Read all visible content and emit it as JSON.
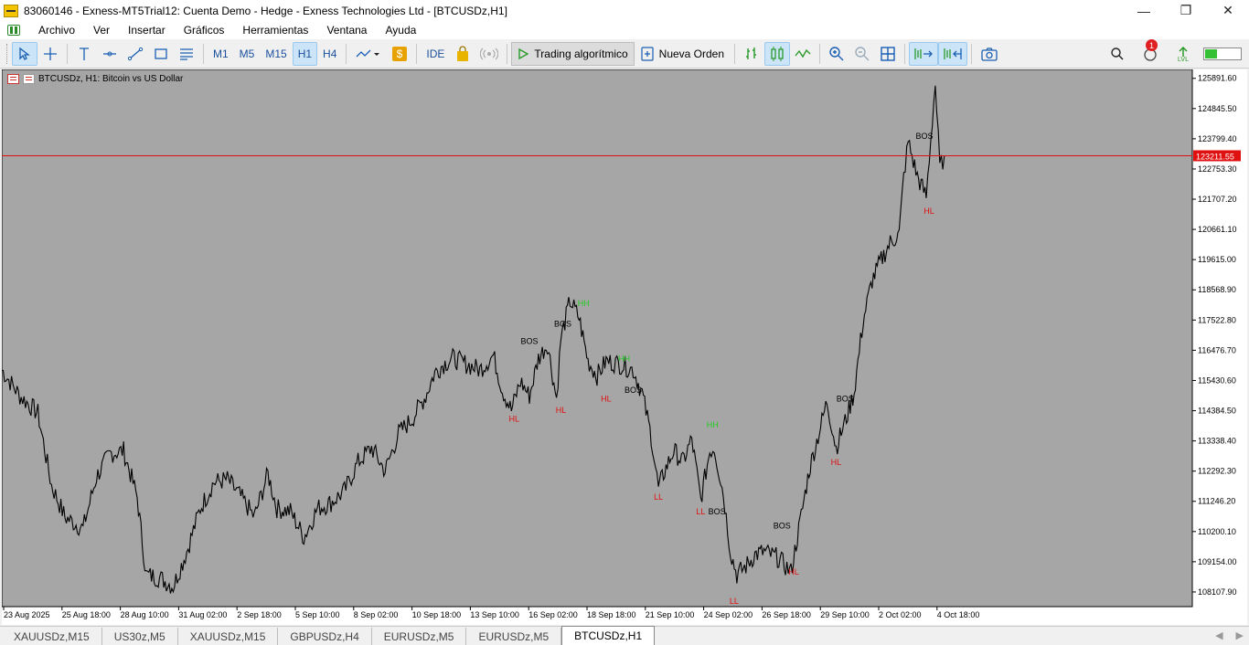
{
  "window": {
    "title": "83060146 - Exness-MT5Trial12: Cuenta Demo - Hedge - Exness Technologies Ltd - [BTCUSDz,H1]",
    "minimize": "—",
    "maximize": "❐",
    "close": "✕"
  },
  "menu": [
    "Archivo",
    "Ver",
    "Insertar",
    "Gráficos",
    "Herramientas",
    "Ventana",
    "Ayuda"
  ],
  "toolbar": {
    "timeframes": [
      "M1",
      "M5",
      "M15",
      "H1",
      "H4"
    ],
    "active_timeframe": "H1",
    "ide_label": "IDE",
    "algo_label": "Trading algorítmico",
    "new_order_label": "Nueva Orden",
    "notifications_count": "1",
    "signal_label": "LVL",
    "battery_level": 0.32
  },
  "chart": {
    "header": "BTCUSDz, H1:  Bitcoin vs US Dollar",
    "current_price": "123211.55",
    "price_line_color": "#e01010"
  },
  "chart_data": {
    "type": "line",
    "symbol": "BTCUSDz",
    "timeframe": "H1",
    "y_ticks": [
      "125891.60",
      "124845.50",
      "123799.40",
      "122753.30",
      "121707.20",
      "120661.10",
      "119615.00",
      "118568.90",
      "117522.80",
      "116476.70",
      "115430.60",
      "114384.50",
      "113338.40",
      "112292.30",
      "111246.20",
      "110200.10",
      "109154.00",
      "108107.90"
    ],
    "x_ticks": [
      "23 Aug 2025",
      "25 Aug 18:00",
      "28 Aug 10:00",
      "31 Aug 02:00",
      "2 Sep 18:00",
      "5 Sep 10:00",
      "8 Sep 02:00",
      "10 Sep 18:00",
      "13 Sep 10:00",
      "16 Sep 02:00",
      "18 Sep 18:00",
      "21 Sep 10:00",
      "24 Sep 02:00",
      "26 Sep 18:00",
      "29 Sep 10:00",
      "2 Oct 02:00",
      "4 Oct 18:00"
    ],
    "ylim": [
      107600,
      126200
    ],
    "x_index_range": [
      0,
      1320
    ],
    "series": [
      {
        "x": [
          0,
          20,
          40,
          55,
          70,
          90,
          105,
          120,
          135,
          150,
          160,
          175,
          190,
          205,
          220,
          235,
          250,
          265,
          280,
          295,
          305,
          320,
          335,
          350,
          365,
          380,
          395,
          410,
          425,
          440,
          455,
          470,
          480,
          490,
          500,
          515,
          530,
          545,
          555,
          565,
          575,
          585,
          595,
          605,
          615,
          620,
          630,
          640,
          650,
          660,
          670,
          685,
          700,
          710,
          720,
          728,
          735,
          745,
          755,
          765,
          775,
          785,
          790,
          800,
          808,
          815,
          825,
          835,
          845,
          860,
          875,
          885,
          895,
          905,
          915,
          925,
          935,
          945,
          955,
          965,
          975,
          985,
          995,
          1000,
          1005,
          1015,
          1025,
          1030,
          1035,
          1040,
          1045
        ],
        "y": [
          115800,
          114900,
          114300,
          111800,
          110700,
          110300,
          112100,
          112900,
          113000,
          111400,
          108700,
          108600,
          108300,
          109500,
          111000,
          111900,
          112000,
          111400,
          110700,
          112200,
          111000,
          110900,
          110000,
          111000,
          111200,
          111600,
          112600,
          113100,
          112300,
          113600,
          114100,
          114900,
          115700,
          116000,
          116200,
          116000,
          115800,
          116300,
          115100,
          114400,
          115400,
          114900,
          116200,
          116700,
          114800,
          116900,
          118200,
          117600,
          116100,
          115600,
          116100,
          116000,
          115800,
          115000,
          113500,
          111700,
          112300,
          113000,
          112600,
          113400,
          111300,
          113000,
          113100,
          111500,
          109500,
          108700,
          109000,
          109400,
          109500,
          109300,
          108800,
          110500,
          112300,
          113500,
          114700,
          113100,
          114000,
          115000,
          117500,
          118900,
          119600,
          120200,
          120500,
          122500,
          123700,
          122500,
          121800,
          123800,
          125700,
          122800,
          123200
        ]
      }
    ],
    "annotations": [
      {
        "text": "BOS",
        "x": 585,
        "y": 116700,
        "color": "#000000"
      },
      {
        "text": "BOS",
        "x": 622,
        "y": 117300,
        "color": "#000000"
      },
      {
        "text": "HH",
        "x": 645,
        "y": 118000,
        "color": "#22cc22"
      },
      {
        "text": "HH",
        "x": 690,
        "y": 116100,
        "color": "#22cc22"
      },
      {
        "text": "BOS",
        "x": 700,
        "y": 115000,
        "color": "#000000"
      },
      {
        "text": "HL",
        "x": 568,
        "y": 114000,
        "color": "#e01010"
      },
      {
        "text": "HL",
        "x": 620,
        "y": 114300,
        "color": "#e01010"
      },
      {
        "text": "HL",
        "x": 670,
        "y": 114700,
        "color": "#e01010"
      },
      {
        "text": "HH",
        "x": 788,
        "y": 113800,
        "color": "#22cc22"
      },
      {
        "text": "LL",
        "x": 728,
        "y": 111300,
        "color": "#e01010"
      },
      {
        "text": "LL",
        "x": 775,
        "y": 110800,
        "color": "#e01010"
      },
      {
        "text": "BOS",
        "x": 793,
        "y": 110800,
        "color": "#000000"
      },
      {
        "text": "BOS",
        "x": 865,
        "y": 110300,
        "color": "#000000"
      },
      {
        "text": "LL",
        "x": 812,
        "y": 107700,
        "color": "#e01010"
      },
      {
        "text": "HL",
        "x": 878,
        "y": 108700,
        "color": "#e01010"
      },
      {
        "text": "BOS",
        "x": 935,
        "y": 114700,
        "color": "#000000"
      },
      {
        "text": "HL",
        "x": 925,
        "y": 112500,
        "color": "#e01010"
      },
      {
        "text": "BOS",
        "x": 1023,
        "y": 123800,
        "color": "#000000"
      },
      {
        "text": "HL",
        "x": 1028,
        "y": 121200,
        "color": "#e01010"
      }
    ],
    "price_line": 123211.55,
    "line_color": "#000000",
    "background": "#a6a6a6",
    "grid": false
  },
  "tabs": [
    "XAUUSDz,M15",
    "US30z,M5",
    "XAUUSDz,M15",
    "GBPUSDz,H4",
    "EURUSDz,M5",
    "EURUSDz,M5",
    "BTCUSDz,H1"
  ],
  "active_tab": "BTCUSDz,H1",
  "tab_arrows": [
    "◀",
    "▶"
  ]
}
